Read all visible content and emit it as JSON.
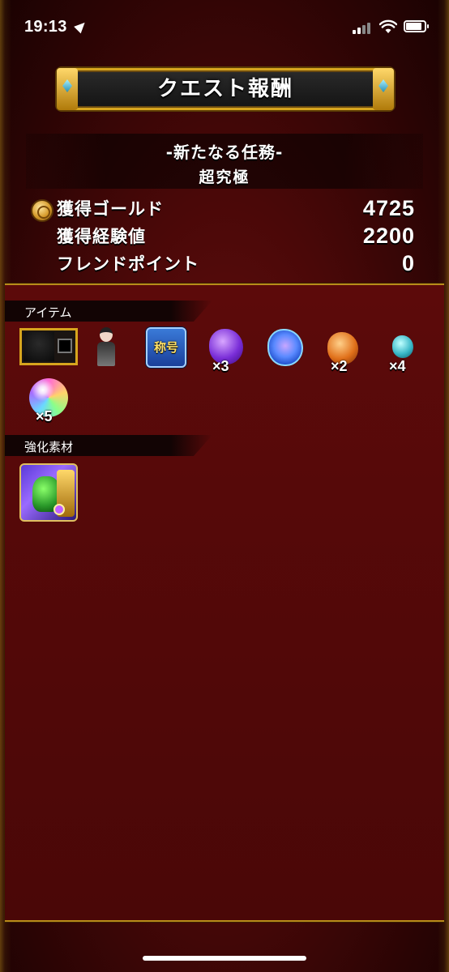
{
  "status_bar": {
    "time": "19:13",
    "battery_level": 0.85
  },
  "title": "クエスト報酬",
  "quest": {
    "name": "-新たなる任務-",
    "difficulty": "超究極"
  },
  "rewards": [
    {
      "label": "獲得ゴールド",
      "value": "4725",
      "icon": "gold-coin-icon"
    },
    {
      "label": "獲得経験値",
      "value": "2200"
    },
    {
      "label": "フレンドポイント",
      "value": "0"
    }
  ],
  "sections": {
    "items_title": "アイテム",
    "materials_title": "強化素材"
  },
  "items": [
    {
      "name": "frame-item",
      "qty": ""
    },
    {
      "name": "avatar-item",
      "qty": ""
    },
    {
      "name": "title-badge",
      "badge_text": "称号",
      "qty": ""
    },
    {
      "name": "purple-orb",
      "qty": "×3"
    },
    {
      "name": "blue-orb",
      "qty": ""
    },
    {
      "name": "orange-orb",
      "qty": "×2"
    },
    {
      "name": "teal-orb",
      "qty": "×4"
    },
    {
      "name": "rainbow-orb",
      "qty": "×5"
    }
  ],
  "colors": {
    "gold_border": "#d7a51e",
    "background": "#4a0808"
  }
}
